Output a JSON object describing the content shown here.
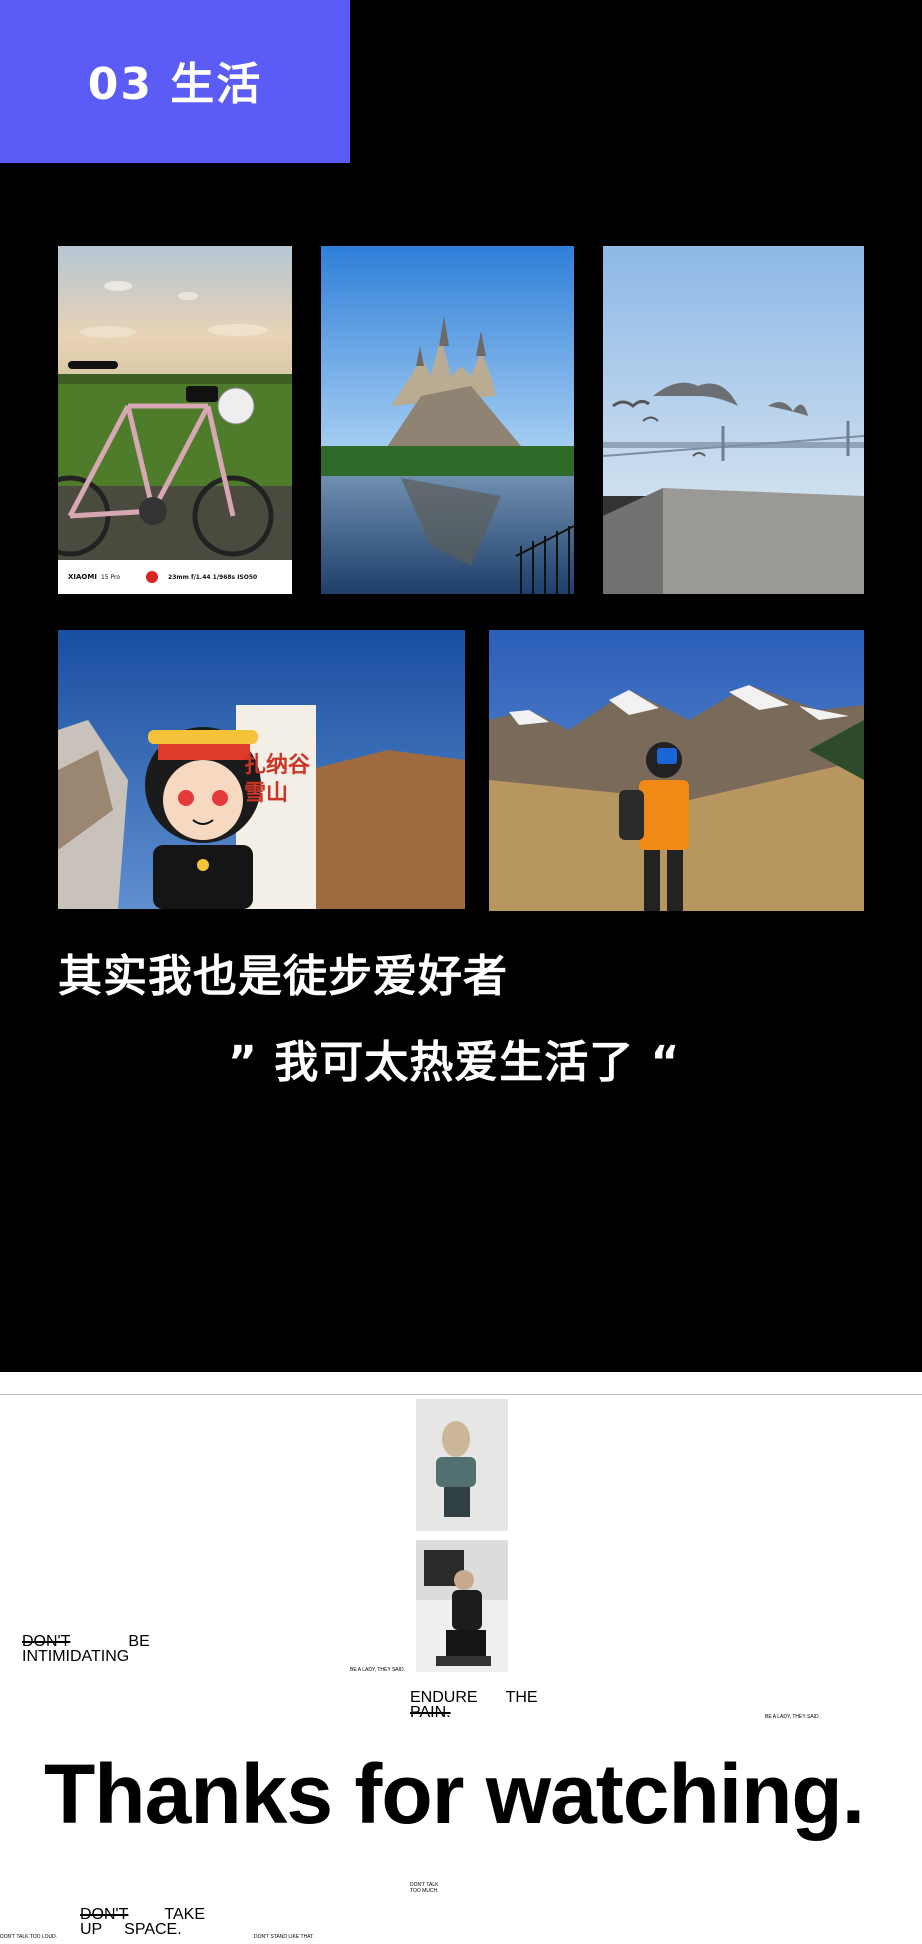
{
  "section_tag": "03 生活",
  "photos": {
    "bike": {
      "camera_brand": "XIAOMI",
      "camera_model": "15 Pro",
      "shot_params": "23mm  f/1.44  1/968s  ISO50"
    },
    "summit_marker_text": "扎纳谷\n雪山"
  },
  "headline": "其实我也是徒步爱好者",
  "quote": "” 我可太热爱生活了 “",
  "bottom": {
    "slogan_1_struck": "DON'T",
    "slogan_1_rest": "BE",
    "slogan_1_line2": "INTIMIDATING",
    "small_note_left": "BE A LADY, THEY SAID.",
    "slogan_2_line1_a": "ENDURE",
    "slogan_2_line1_b": "THE",
    "slogan_2_struck": "PAIN.",
    "small_note_right": "BE A LADY, THEY SAID.",
    "thanks": "Thanks for watching.",
    "small_note_mid": "DON'T TALK TOO MUCH.",
    "slogan_3_struck": "DON'T",
    "slogan_3_rest": "TAKE",
    "slogan_3_line2": "UP     SPACE.",
    "small_note_bottom_left": "DON'T TALK TOO LOUD.",
    "small_note_bottom_right": "DON'T STAND LIKE THAT."
  },
  "colors": {
    "tag_bg": "#5b5bf5",
    "background_top": "#000000",
    "background_bottom": "#ffffff"
  }
}
